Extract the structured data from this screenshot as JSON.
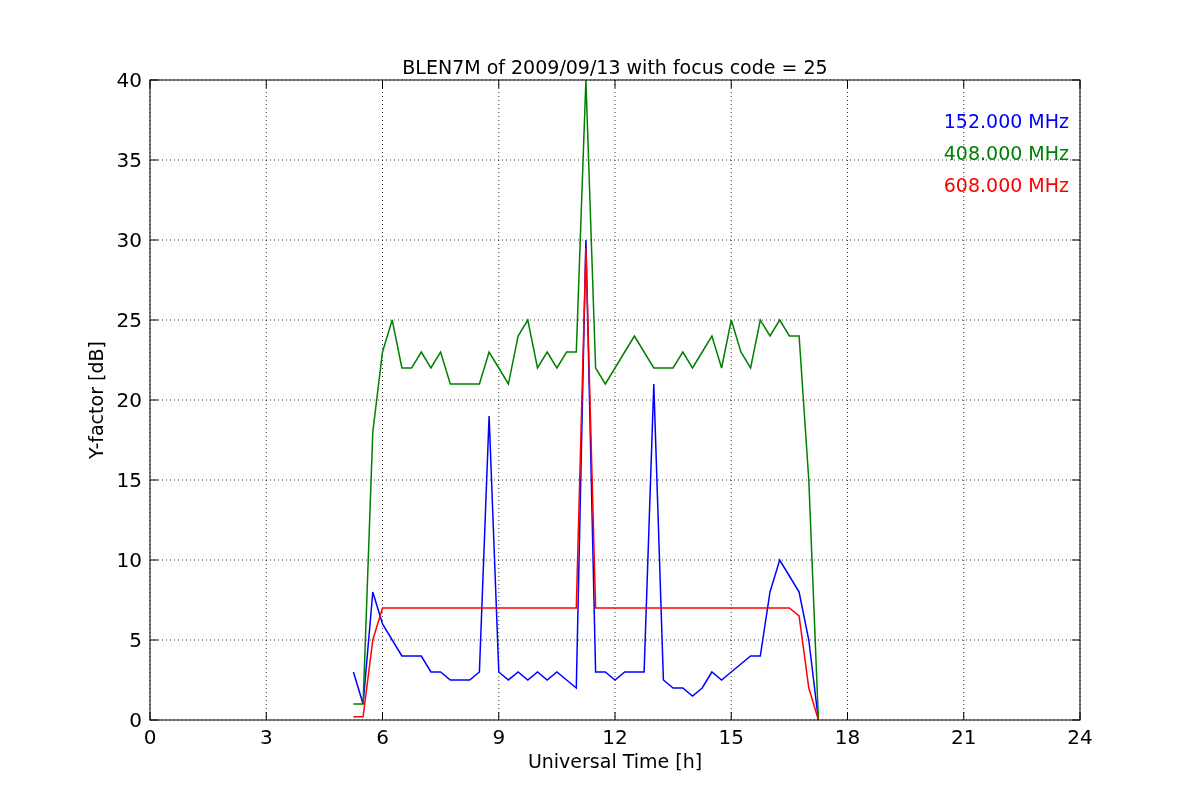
{
  "chart_data": {
    "type": "line",
    "title": "BLEN7M of 2009/09/13 with focus code = 25",
    "xlabel": "Universal Time [h]",
    "ylabel": "Y-factor [dB]",
    "x": [
      5.25,
      5.5,
      5.75,
      6,
      6.25,
      6.5,
      6.75,
      7,
      7.25,
      7.5,
      7.75,
      8,
      8.25,
      8.5,
      8.75,
      9,
      9.25,
      9.5,
      9.75,
      10,
      10.25,
      10.5,
      10.75,
      11,
      11.25,
      11.5,
      11.75,
      12,
      12.25,
      12.5,
      12.75,
      13,
      13.25,
      13.5,
      13.75,
      14,
      14.25,
      14.5,
      14.75,
      15,
      15.25,
      15.5,
      15.75,
      16,
      16.25,
      16.5,
      16.75,
      17,
      17.25
    ],
    "series": [
      {
        "name": "152.000 MHz",
        "color": "#0000ff",
        "values": [
          3,
          1,
          8,
          6,
          5,
          4,
          4,
          4,
          3,
          3,
          2.5,
          2.5,
          2.5,
          3,
          19,
          3,
          2.5,
          3,
          2.5,
          3,
          2.5,
          3,
          2.5,
          2,
          30,
          3,
          3,
          2.5,
          3,
          3,
          3,
          21,
          2.5,
          2,
          2,
          1.5,
          2,
          3,
          2.5,
          3,
          3.5,
          4,
          4,
          8,
          10,
          9,
          8,
          5,
          0
        ]
      },
      {
        "name": "408.000 MHz",
        "color": "#008000",
        "values": [
          1,
          1,
          18,
          23,
          25,
          22,
          22,
          23,
          22,
          23,
          21,
          21,
          21,
          21,
          23,
          22,
          21,
          24,
          25,
          22,
          23,
          22,
          23,
          23,
          40,
          22,
          21,
          22,
          23,
          24,
          23,
          22,
          22,
          22,
          23,
          22,
          23,
          24,
          22,
          25,
          23,
          22,
          25,
          24,
          25,
          24,
          24,
          15,
          0
        ]
      },
      {
        "name": "608.000 MHz",
        "color": "#ff0000",
        "values": [
          0.2,
          0.2,
          5,
          7,
          7,
          7,
          7,
          7,
          7,
          7,
          7,
          7,
          7,
          7,
          7,
          7,
          7,
          7,
          7,
          7,
          7,
          7,
          7,
          7,
          29.5,
          7,
          7,
          7,
          7,
          7,
          7,
          7,
          7,
          7,
          7,
          7,
          7,
          7,
          7,
          7,
          7,
          7,
          7,
          7,
          7,
          7,
          6.5,
          2,
          0
        ]
      }
    ],
    "xlim": [
      0,
      24
    ],
    "ylim": [
      0,
      40
    ],
    "xticks": [
      0,
      3,
      6,
      9,
      12,
      15,
      18,
      21,
      24
    ],
    "yticks": [
      0,
      5,
      10,
      15,
      20,
      25,
      30,
      35,
      40
    ],
    "grid": true
  }
}
